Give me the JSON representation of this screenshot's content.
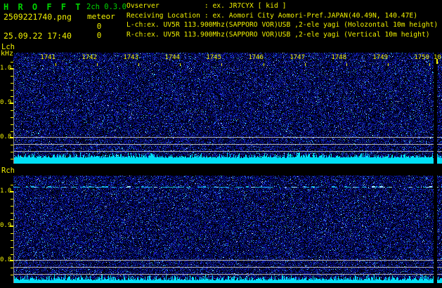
{
  "header": {
    "title": "H R O F F T",
    "version": "2ch 0.3.0",
    "mode": "meteor",
    "filename": "2509221740.png",
    "datetime": "25.09.22 17:40",
    "counter_top": "0",
    "counter_bottom": "0",
    "info_lines": {
      "observer": "Ovserver           : ex. JR7CYX [ kid ]",
      "location": "Receiving Location : ex. Aomori City Aomori-Pref.JAPAN(40.49N, 140.47E)",
      "lch": "L-ch:ex. UV5R 113.900Mhz(SAPPORO VOR)USB ,2-ele yagi (Holozontal 10m height)",
      "rch": "R-ch:ex. UV5R 113.900Mhz(SAPPORO VOR)USB ,2-ele yagi (Vertical 10m height)"
    }
  },
  "axes": {
    "freq_unit": "kHz",
    "freq_tick_labels": [
      "1.0",
      "0.9",
      "0.8"
    ],
    "time_tick_labels": [
      "1741",
      "1742",
      "1743",
      "1744",
      "1745",
      "1746",
      "1747",
      "1748",
      "1749",
      "1750"
    ],
    "time_partial_label": "10"
  },
  "panels": {
    "left": {
      "label": "Lch"
    },
    "right": {
      "label": "Rch"
    }
  },
  "colors": {
    "title_green": "#00d400",
    "text_yellow": "#f2f200",
    "signal_cyan": "#00dff5",
    "reference_gray": "#b4b4b4",
    "noise_blue": "#1515c8",
    "background": "#000000"
  }
}
